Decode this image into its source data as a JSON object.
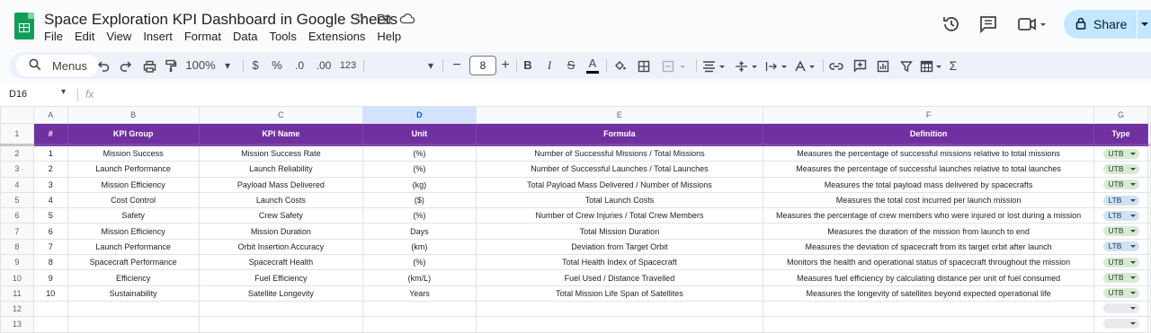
{
  "app": {
    "title": "Space Exploration KPI Dashboard in Google Sheets",
    "menu": [
      "File",
      "Edit",
      "View",
      "Insert",
      "Format",
      "Data",
      "Tools",
      "Extensions",
      "Help"
    ],
    "share_label": "Share"
  },
  "toolbar": {
    "search_label": "Menus",
    "zoom": "100%",
    "currency": "$",
    "percent": "%",
    "dec_decrease": ".0",
    "dec_increase": ".00",
    "format_123": "123",
    "font_size": "8",
    "bold": "B",
    "italic": "I",
    "strike": "S",
    "text_color": "A",
    "text_color_accent": "#000000"
  },
  "formula_bar": {
    "cell_ref": "D16",
    "fx": "fx"
  },
  "sheet": {
    "columns": [
      "A",
      "B",
      "C",
      "D",
      "E",
      "F",
      "G"
    ],
    "selected_column": "D",
    "row_numbers": [
      "1",
      "2",
      "3",
      "4",
      "5",
      "6",
      "7",
      "8",
      "9",
      "10",
      "11",
      "12",
      "13"
    ],
    "header": [
      "#",
      "KPI Group",
      "KPI Name",
      "Unit",
      "Formula",
      "Definition",
      "Type"
    ],
    "header_color": "#7030a0",
    "rows": [
      {
        "n": "1",
        "group": "Mission Success",
        "name": "Mission Success Rate",
        "unit": "(%)",
        "formula": "Number of Successful Missions / Total Missions",
        "definition": "Measures the percentage of successful missions relative to total missions",
        "type": "UTB"
      },
      {
        "n": "2",
        "group": "Launch Performance",
        "name": "Launch Reliability",
        "unit": "(%)",
        "formula": "Number of Successful Launches / Total Launches",
        "definition": "Measures the percentage of successful launches relative to total launches",
        "type": "UTB"
      },
      {
        "n": "3",
        "group": "Mission Efficiency",
        "name": "Payload Mass Delivered",
        "unit": "(kg)",
        "formula": "Total Payload Mass Delivered / Number of Missions",
        "definition": "Measures the total payload mass delivered by spacecrafts",
        "type": "UTB"
      },
      {
        "n": "4",
        "group": "Cost Control",
        "name": "Launch Costs",
        "unit": "($)",
        "formula": "Total Launch Costs",
        "definition": "Measures the total cost incurred per launch mission",
        "type": "LTB"
      },
      {
        "n": "5",
        "group": "Safety",
        "name": "Crew Safety",
        "unit": "(%)",
        "formula": "Number of Crew Injuries / Total Crew Members",
        "definition": "Measures the percentage of crew members who were injured or lost during a mission",
        "type": "LTB"
      },
      {
        "n": "6",
        "group": "Mission Efficiency",
        "name": "Mission Duration",
        "unit": "Days",
        "formula": "Total Mission Duration",
        "definition": "Measures the duration of the mission from launch to end",
        "type": "UTB"
      },
      {
        "n": "7",
        "group": "Launch Performance",
        "name": "Orbit Insertion Accuracy",
        "unit": "(km)",
        "formula": "Deviation from Target Orbit",
        "definition": "Measures the deviation of spacecraft from its target orbit after launch",
        "type": "LTB"
      },
      {
        "n": "8",
        "group": "Spacecraft Performance",
        "name": "Spacecraft Health",
        "unit": "(%)",
        "formula": "Total Health Index of Spacecraft",
        "definition": "Monitors the health and operational status of spacecraft throughout the mission",
        "type": "UTB"
      },
      {
        "n": "9",
        "group": "Efficiency",
        "name": "Fuel Efficiency",
        "unit": "(km/L)",
        "formula": "Fuel Used / Distance Travelled",
        "definition": "Measures fuel efficiency by calculating distance per unit of fuel consumed",
        "type": "UTB"
      },
      {
        "n": "10",
        "group": "Sustainability",
        "name": "Satellite Longevity",
        "unit": "Years",
        "formula": "Total Mission Life Span of Satellites",
        "definition": "Measures the longevity of satellites beyond expected operational life",
        "type": "UTB"
      },
      {
        "n": "",
        "group": "",
        "name": "",
        "unit": "",
        "formula": "",
        "definition": "",
        "type": ""
      },
      {
        "n": "",
        "group": "",
        "name": "",
        "unit": "",
        "formula": "",
        "definition": "",
        "type": ""
      }
    ]
  }
}
